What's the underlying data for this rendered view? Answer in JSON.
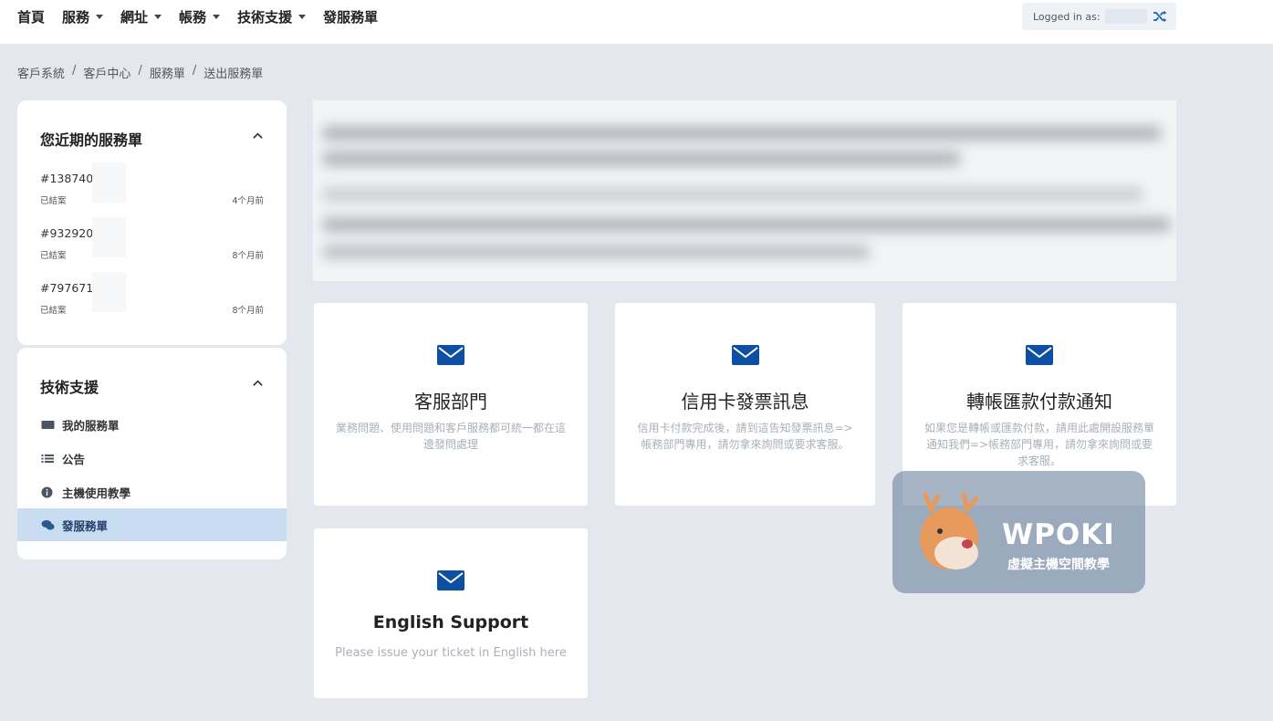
{
  "nav": {
    "items": [
      {
        "label": "首頁",
        "has_caret": false
      },
      {
        "label": "服務",
        "has_caret": true
      },
      {
        "label": "網址",
        "has_caret": true
      },
      {
        "label": "帳務",
        "has_caret": true
      },
      {
        "label": "技術支援",
        "has_caret": true
      },
      {
        "label": "發服務單",
        "has_caret": false
      }
    ],
    "logged_in_label": "Logged in as:"
  },
  "breadcrumb": [
    "客戶系統",
    "客戶中心",
    "服務單",
    "送出服務單"
  ],
  "recent_tickets": {
    "title": "您近期的服務單",
    "items": [
      {
        "id": "#138740",
        "status": "已結案",
        "time": "4个月前"
      },
      {
        "id": "#932920",
        "status": "已結案",
        "time": "8个月前"
      },
      {
        "id": "#797671",
        "status": "已結案",
        "time": "8个月前"
      }
    ]
  },
  "support_menu": {
    "title": "技術支援",
    "items": [
      {
        "label": "我的服務單",
        "icon": "ticket-icon"
      },
      {
        "label": "公告",
        "icon": "list-icon"
      },
      {
        "label": "主機使用教學",
        "icon": "info-icon"
      },
      {
        "label": "發服務單",
        "icon": "comments-icon",
        "active": true
      }
    ]
  },
  "departments": [
    {
      "title": "客服部門",
      "desc": "業務問題、使用問題和客戶服務都可統一都在這邊發問處理"
    },
    {
      "title": "信用卡發票訊息",
      "desc": "信用卡付款完成後，請到這告知發票訊息=>帳務部門專用，請勿拿來詢問或要求客服。"
    },
    {
      "title": "轉帳匯款付款通知",
      "desc": "如果您是轉帳或匯款付款，請用此處開設服務單通知我們=>帳務部門專用，請勿拿來詢問或要求客服。"
    },
    {
      "title": "English Support",
      "desc": "Please issue your ticket in English here"
    }
  ],
  "watermark": {
    "brand": "WPOKI",
    "subtitle": "虛擬主機空間教學"
  },
  "colors": {
    "accent": "#0d4fa3",
    "active_bg": "#c9ddf2",
    "page_bg": "#e4e8ee"
  }
}
